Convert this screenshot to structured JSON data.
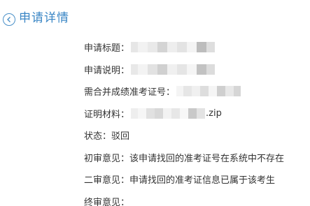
{
  "header": {
    "title": "申请详情",
    "back_icon": "chevron-left-circle-icon"
  },
  "colors": {
    "accent": "#3a86c5",
    "text": "#333333"
  },
  "details": {
    "apply_title_label": "申请标题：",
    "apply_desc_label": "申请说明：",
    "merge_cert_label": "需合并成绩准考证号：",
    "proof_label": "证明材料：",
    "proof_ext": ".zip",
    "status_label": "状态：",
    "status_value": "驳回",
    "first_review_label": "初审意见：",
    "first_review_value": "该申请找回的准考证号在系统中不存在",
    "second_review_label": "二审意见：",
    "second_review_value": "申请找回的准考证信息已属于该考生",
    "final_review_label": "终审意见：",
    "final_review_value": ""
  }
}
